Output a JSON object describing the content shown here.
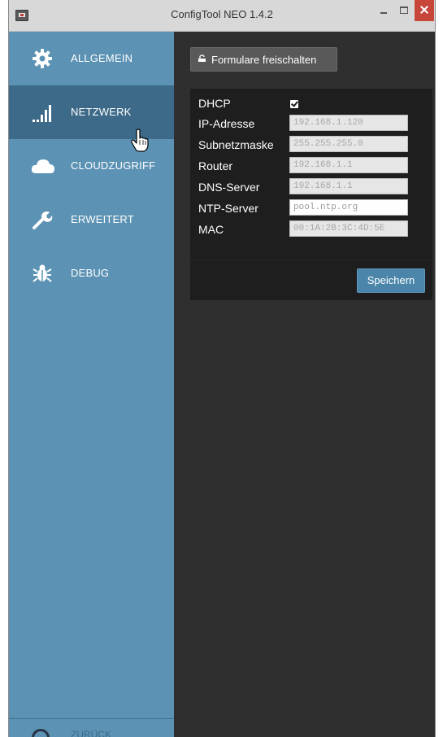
{
  "window": {
    "title": "ConfigTool NEO 1.4.2"
  },
  "sidebar": {
    "items": [
      {
        "label": "ALLGEMEIN",
        "icon": "gear-icon"
      },
      {
        "label": "NETZWERK",
        "icon": "signal-bars-icon",
        "active": true
      },
      {
        "label": "CLOUDZUGRIFF",
        "icon": "cloud-icon"
      },
      {
        "label": "ERWEITERT",
        "icon": "wrench-icon"
      },
      {
        "label": "DEBUG",
        "icon": "bug-icon"
      }
    ],
    "footer": {
      "label": "ZURÜCK",
      "icon": "back-arrow-icon"
    }
  },
  "main": {
    "unlock_button": {
      "label": "Formulare freischalten",
      "icon": "unlock-icon"
    },
    "fields": [
      {
        "label": "DHCP",
        "type": "checkbox",
        "checked": true
      },
      {
        "label": "IP-Adresse",
        "value": "192.168.1.120"
      },
      {
        "label": "Subnetzmaske",
        "value": "255.255.255.0"
      },
      {
        "label": "Router",
        "value": "192.168.1.1"
      },
      {
        "label": "DNS-Server",
        "value": "192.168.1.1"
      },
      {
        "label": "NTP-Server",
        "value": "pool.ntp.org"
      },
      {
        "label": "MAC",
        "value": "00:1A:2B:3C:4D:5E"
      }
    ],
    "save_button": {
      "label": "Speichern"
    }
  },
  "colors": {
    "sidebar": "#5c92b4",
    "sidebar_active": "#3d6a89",
    "content_bg": "#2f2f2f",
    "panel_bg": "#1e1e1e",
    "accent": "#4b86aa",
    "close": "#c8453a"
  }
}
